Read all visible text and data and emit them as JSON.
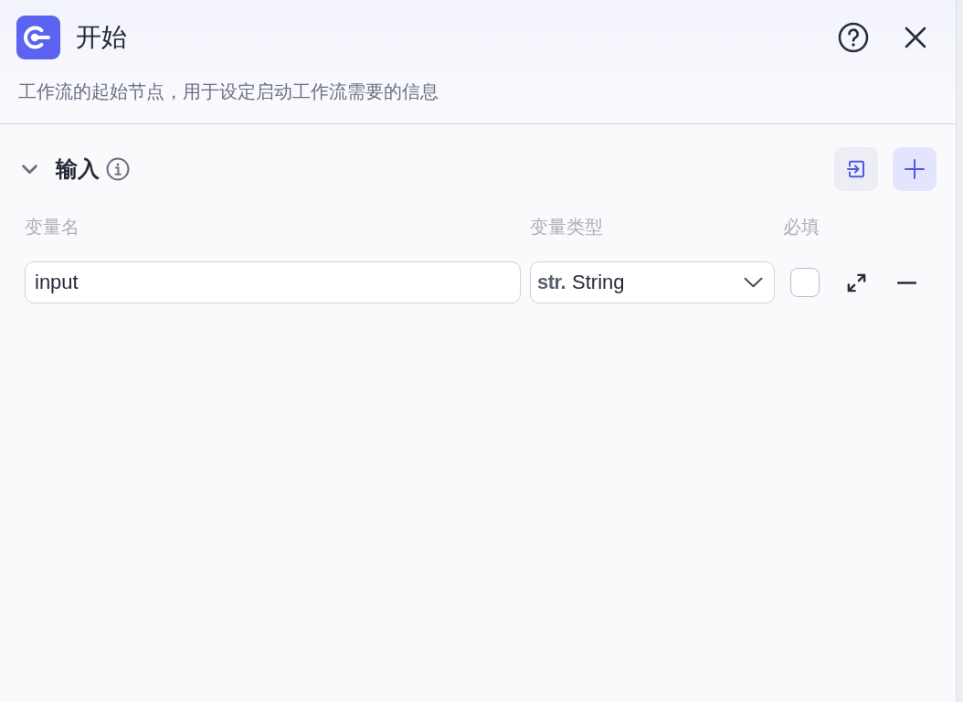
{
  "panel": {
    "title": "开始",
    "description": "工作流的起始节点，用于设定启动工作流需要的信息"
  },
  "input_section": {
    "title": "输入",
    "expanded": true,
    "columns": [
      "变量名",
      "变量类型",
      "必填"
    ],
    "variables": [
      {
        "name": "input",
        "type_prefix": "str.",
        "type": "String",
        "required": false
      }
    ]
  }
}
